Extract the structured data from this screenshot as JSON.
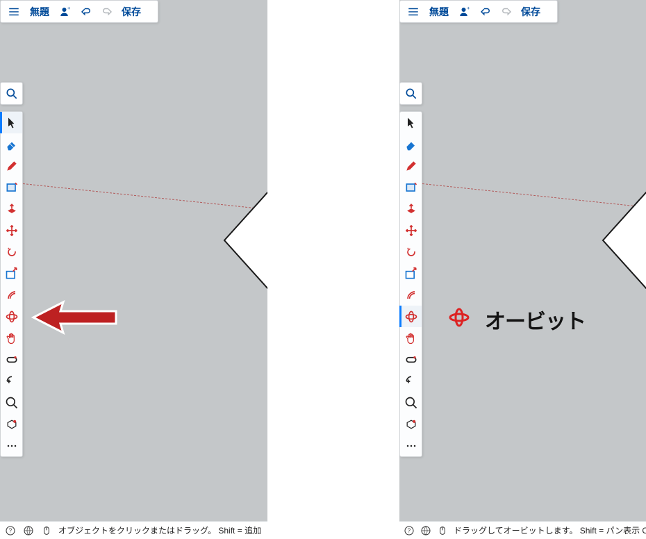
{
  "top": {
    "title": "無題",
    "save": "保存"
  },
  "status_left": "オブジェクトをクリックまたはドラッグ。 Shift = 追加",
  "status_right": "ドラッグしてオービットします。 Shift = パン表示    O",
  "tooltip_label": "オービット",
  "colors": {
    "primary": "#004a99",
    "accent": "#bf2727"
  }
}
